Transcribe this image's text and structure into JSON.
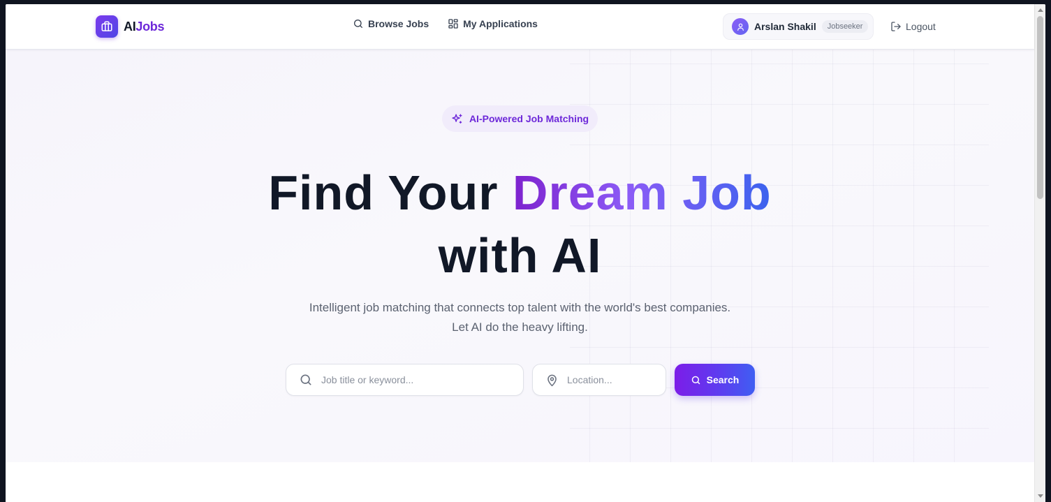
{
  "brand": {
    "ai": "AI",
    "jobs": "Jobs",
    "colors": {
      "primary": "#6d28d9",
      "accent": "#3b63ee"
    }
  },
  "nav": {
    "browse_jobs": {
      "label": "Browse Jobs",
      "icon": "search-icon"
    },
    "my_applications": {
      "label": "My Applications",
      "icon": "grid-icon"
    }
  },
  "user": {
    "name": "Arslan Shakil",
    "role": "Jobseeker",
    "avatar_icon": "user-icon"
  },
  "logout": {
    "label": "Logout",
    "icon": "logout-icon"
  },
  "hero": {
    "badge": "AI-Powered Job Matching",
    "headline_part1": "Find Your ",
    "headline_highlight": "Dream Job",
    "headline_part2": "with AI",
    "subtitle_line1": "Intelligent job matching that connects top talent with the world's best companies.",
    "subtitle_line2": "Let AI do the heavy lifting."
  },
  "search": {
    "keyword_placeholder": "Job title or keyword...",
    "keyword_value": "",
    "location_placeholder": "Location...",
    "location_value": "",
    "button_label": "Search"
  }
}
